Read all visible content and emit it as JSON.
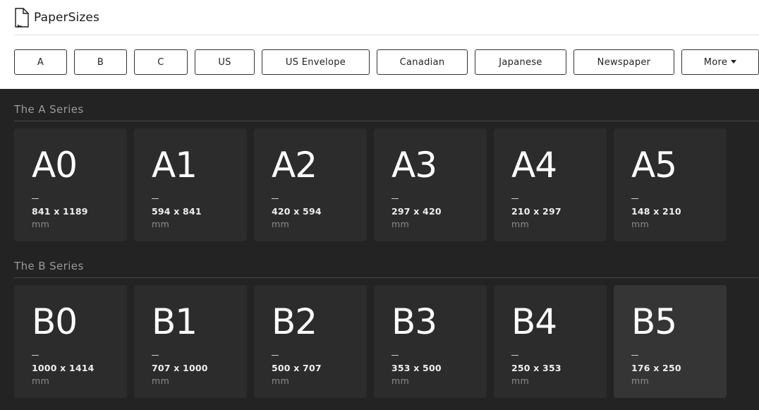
{
  "header": {
    "logo_text": "PaperSizes",
    "logo_icon": "document-icon"
  },
  "nav": [
    {
      "id": "a",
      "label": "A"
    },
    {
      "id": "b",
      "label": "B"
    },
    {
      "id": "c",
      "label": "C"
    },
    {
      "id": "us",
      "label": "US"
    },
    {
      "id": "us-envelope",
      "label": "US Envelope"
    },
    {
      "id": "canadian",
      "label": "Canadian"
    },
    {
      "id": "japanese",
      "label": "Japanese"
    },
    {
      "id": "newspaper",
      "label": "Newspaper"
    },
    {
      "id": "more",
      "label": "More",
      "has_dropdown": true
    }
  ],
  "sections": [
    {
      "title": "The A Series",
      "cards": [
        {
          "name": "A0",
          "dims": "841 x 1189",
          "unit": "mm"
        },
        {
          "name": "A1",
          "dims": "594 x 841",
          "unit": "mm"
        },
        {
          "name": "A2",
          "dims": "420 x 594",
          "unit": "mm"
        },
        {
          "name": "A3",
          "dims": "297 x 420",
          "unit": "mm"
        },
        {
          "name": "A4",
          "dims": "210 x 297",
          "unit": "mm"
        },
        {
          "name": "A5",
          "dims": "148 x 210",
          "unit": "mm"
        }
      ]
    },
    {
      "title": "The B Series",
      "cards": [
        {
          "name": "B0",
          "dims": "1000 x 1414",
          "unit": "mm"
        },
        {
          "name": "B1",
          "dims": "707 x 1000",
          "unit": "mm"
        },
        {
          "name": "B2",
          "dims": "500 x 707",
          "unit": "mm"
        },
        {
          "name": "B3",
          "dims": "353 x 500",
          "unit": "mm"
        },
        {
          "name": "B4",
          "dims": "250 x 353",
          "unit": "mm"
        },
        {
          "name": "B5",
          "dims": "176 x 250",
          "unit": "mm",
          "hovered": true
        }
      ]
    }
  ],
  "colors": {
    "page_background": "#232323",
    "card_background": "#2c2c2c",
    "card_hover_background": "#353535",
    "header_background": "#ffffff"
  }
}
